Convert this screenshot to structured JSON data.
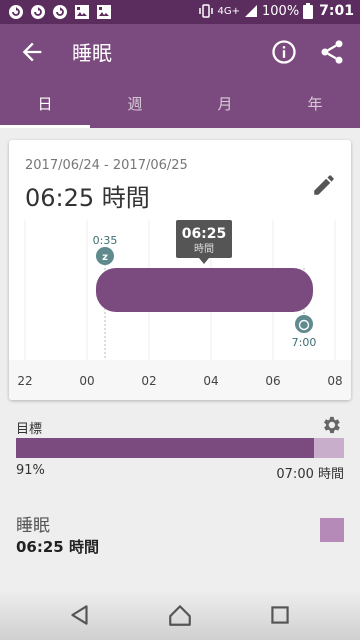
{
  "status_bar": {
    "network": "4G+",
    "battery": "100%",
    "time": "7:01"
  },
  "app_bar": {
    "title": "睡眠",
    "icons": [
      "back-arrow-icon",
      "info-icon",
      "share-icon"
    ]
  },
  "tabs": [
    {
      "label": "日",
      "active": true
    },
    {
      "label": "週",
      "active": false
    },
    {
      "label": "月",
      "active": false
    },
    {
      "label": "年",
      "active": false
    }
  ],
  "summary": {
    "date_range": "2017/06/24 - 2017/06/25",
    "duration": "06:25 時間"
  },
  "chart_data": {
    "type": "bar",
    "x_ticks": [
      "22",
      "00",
      "02",
      "04",
      "06",
      "08"
    ],
    "x_range_hours": [
      22,
      32
    ],
    "sleep_start_label": "0:35",
    "sleep_end_label": "7:00",
    "sleep_start_hour": 24.58,
    "sleep_end_hour": 31.0,
    "tooltip_value": "06:25",
    "tooltip_unit": "時間",
    "bar_color": "#7b4a7e",
    "marker_color": "#5f8a8e"
  },
  "goal": {
    "label": "目標",
    "percent_label": "91%",
    "percent": 91,
    "target_label": "07:00 時間",
    "fill_color": "#7b4a7e",
    "track_color": "#c9aecb"
  },
  "sleep": {
    "title": "睡眠",
    "value": "06:25 時間",
    "swatch_color": "#b58ab8"
  }
}
